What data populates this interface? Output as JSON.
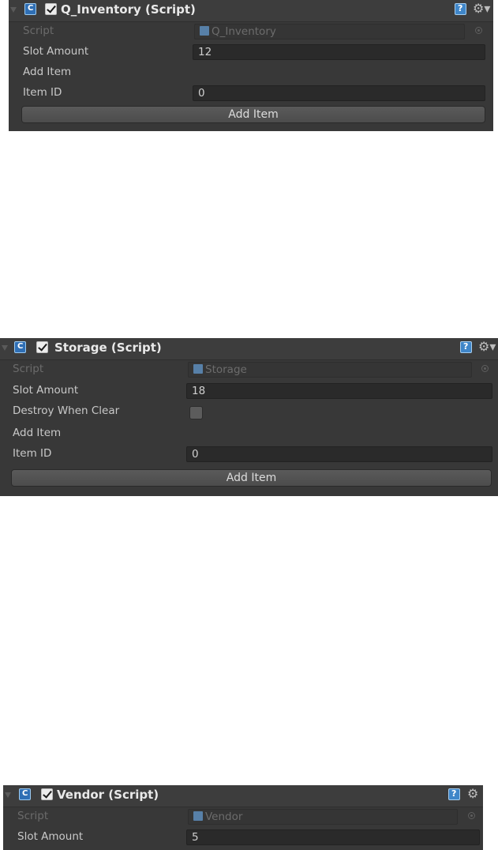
{
  "inspectors": [
    {
      "title": "Q_Inventory (Script)",
      "script_label": "Script",
      "script_value": "Q_Inventory",
      "slot_amount_label": "Slot Amount",
      "slot_amount_value": "12",
      "add_item_header": "Add Item",
      "item_id_label": "Item ID",
      "item_id_value": "0",
      "add_item_button": "Add Item"
    },
    {
      "title": "Storage (Script)",
      "script_label": "Script",
      "script_value": "Storage",
      "slot_amount_label": "Slot Amount",
      "slot_amount_value": "18",
      "destroy_label": "Destroy When Clear",
      "destroy_checked": false,
      "add_item_header": "Add Item",
      "item_id_label": "Item ID",
      "item_id_value": "0",
      "add_item_button": "Add Item"
    },
    {
      "title": "Vendor (Script)",
      "script_label": "Script",
      "script_value": "Vendor",
      "slot_amount_label": "Slot Amount",
      "slot_amount_value": "5"
    }
  ],
  "icons": {
    "foldout": "foldout-arrow-icon",
    "script": "csharp-script-icon",
    "enabled": "checkbox-checked-icon",
    "help": "help-book-icon",
    "settings": "gear-icon",
    "object_picker": "object-picker-icon"
  }
}
